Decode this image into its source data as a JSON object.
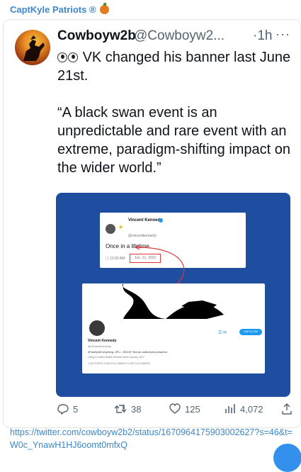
{
  "channel": {
    "title": "CaptKyle Patriots ®"
  },
  "tweet": {
    "author_name": "Cowboyw2b",
    "author_handle": "@Cowboyw2...",
    "time_sep": "·",
    "time": "1h",
    "more": "···",
    "line1": "VK changed his banner last June 21st.",
    "line2": "“A black swan event is an unpredictable and rare event with an extreme, paradigm-shifting impact on the wider world.”"
  },
  "media": {
    "shot1": {
      "name": "Vincent Kennedy",
      "handle": "@vincentkennedy",
      "text": "Once in a lifetime.",
      "time": "12:00 AM",
      "date": "Jun. 21, 2022"
    },
    "shot2": {
      "name": "Vincent Kennedy",
      "handle": "@VincentKennedy",
      "bio": "#FamilyIsEverything. 4PL = ⊕21⊕ *Not an authorized preacher.",
      "meta": "Living in United States   Member since January 2017",
      "counts": "1,204 POSTS   1,466 FOLLOWING   31,082 FOLLOWERS",
      "button": "UNFOLLOW"
    }
  },
  "actions": {
    "replies": "5",
    "reposts": "38",
    "likes": "125",
    "views": "4,072"
  },
  "link": "https://twitter.com/cowboyw2b2/status/1670964175903002627?s=46&t=W0c_YnawH1HJ6oomt0mfxQ"
}
